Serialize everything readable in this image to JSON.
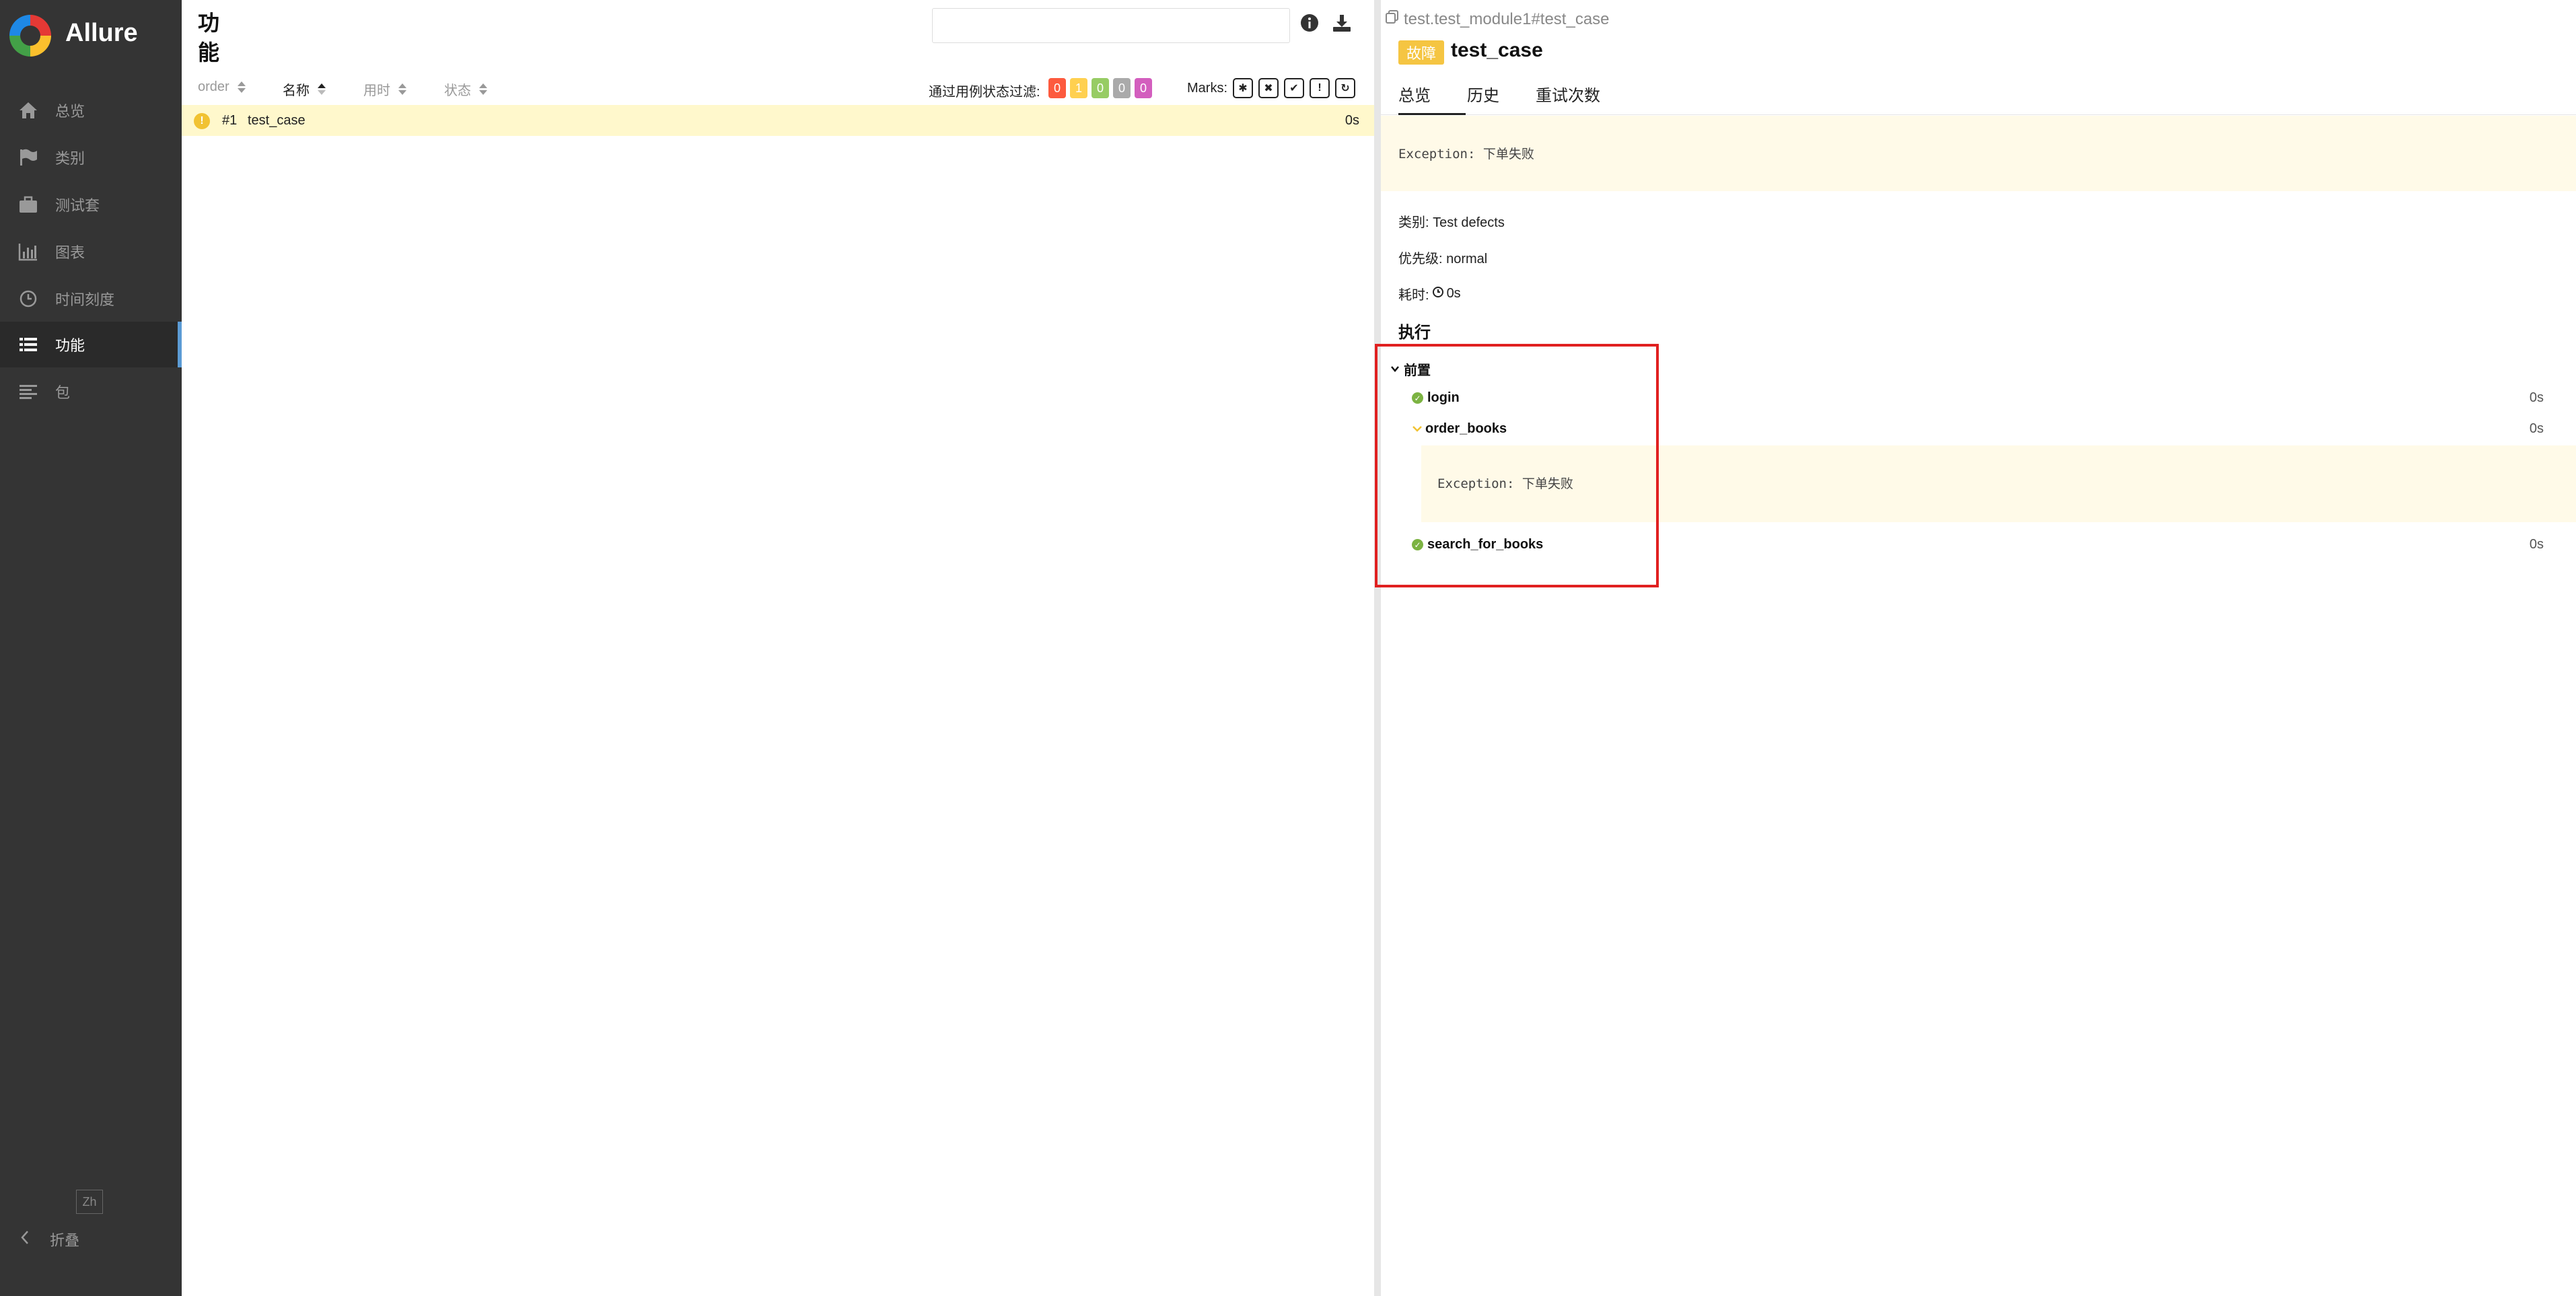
{
  "app": {
    "name": "Allure"
  },
  "sidebar": {
    "items": [
      {
        "label": "总览",
        "icon": "home-icon"
      },
      {
        "label": "类别",
        "icon": "flag-icon"
      },
      {
        "label": "测试套",
        "icon": "briefcase-icon"
      },
      {
        "label": "图表",
        "icon": "bar-chart-icon"
      },
      {
        "label": "时间刻度",
        "icon": "clock-icon"
      },
      {
        "label": "功能",
        "icon": "list-icon",
        "active": true
      },
      {
        "label": "包",
        "icon": "align-left-icon"
      }
    ],
    "lang": "Zh",
    "collapse_label": "折叠"
  },
  "middle": {
    "title": "功能",
    "search": {
      "placeholder": ""
    },
    "columns": {
      "order": "order",
      "name": "名称",
      "duration": "用时",
      "status": "状态"
    },
    "filter_label": "通过用例状态过滤:",
    "status_counts": [
      {
        "value": "0",
        "color": "#fd5a3e"
      },
      {
        "value": "1",
        "color": "#ffd050"
      },
      {
        "value": "0",
        "color": "#97cc64"
      },
      {
        "value": "0",
        "color": "#aaaaaa"
      },
      {
        "value": "0",
        "color": "#d35ebe"
      }
    ],
    "marks_label": "Marks:",
    "rows": [
      {
        "order": "#1",
        "name": "test_case",
        "duration": "0s",
        "status": "broken"
      }
    ]
  },
  "detail": {
    "breadcrumb": "test.test_module1#test_case",
    "status_label": "故障",
    "title": "test_case",
    "tabs": [
      "总览",
      "历史",
      "重试次数"
    ],
    "message": "Exception: 下单失败",
    "category": "类别: Test defects",
    "severity": "优先级: normal",
    "duration_label": "耗时:",
    "duration": "0s",
    "execution_heading": "执行",
    "setup_heading": "前置",
    "steps": [
      {
        "name": "login",
        "duration": "0s",
        "status": "passed"
      },
      {
        "name": "order_books",
        "duration": "0s",
        "status": "broken",
        "message": "Exception: 下单失败"
      },
      {
        "name": "search_for_books",
        "duration": "0s",
        "status": "passed"
      }
    ]
  }
}
